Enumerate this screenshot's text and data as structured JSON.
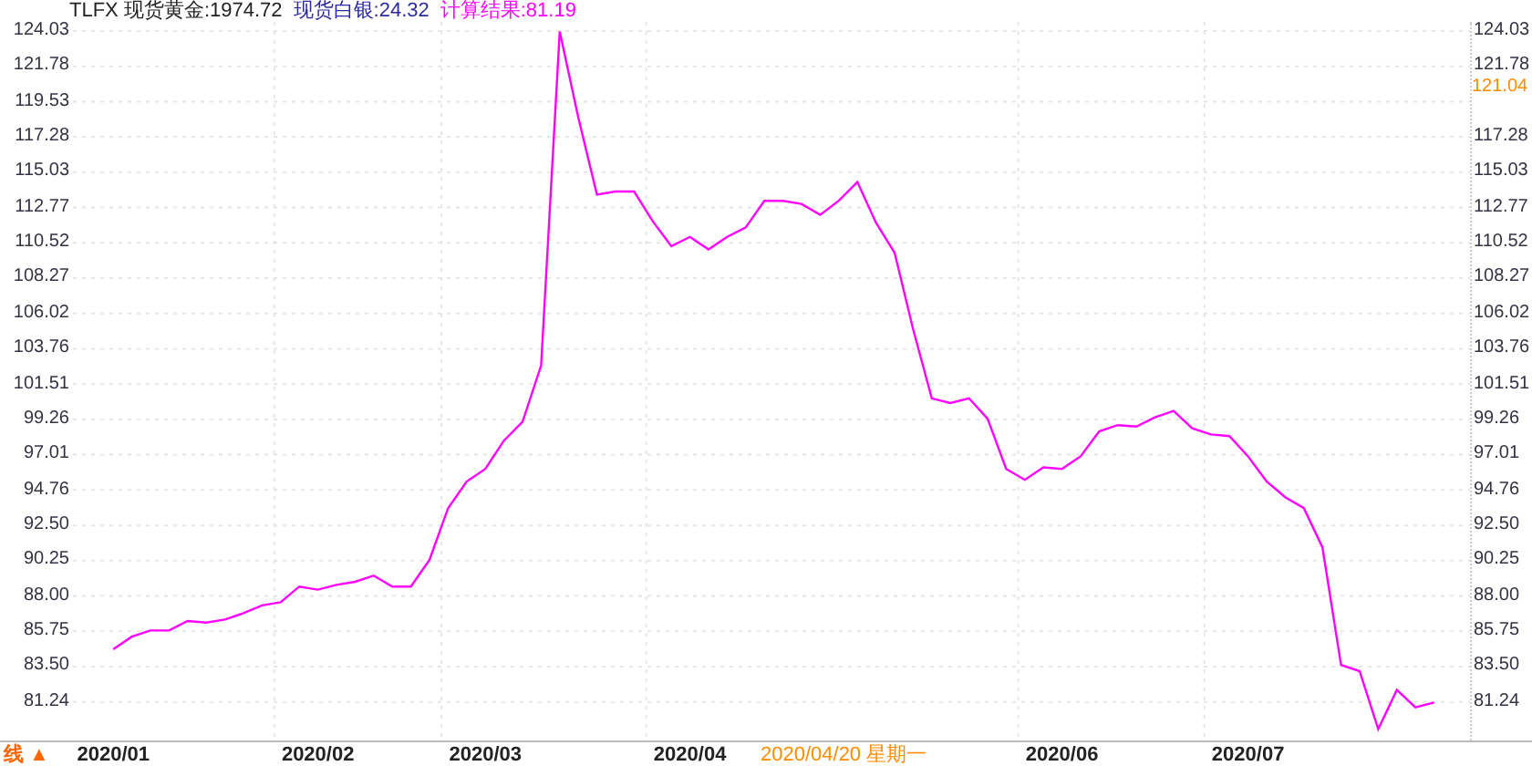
{
  "legend": [
    {
      "text": "TLFX 现货黄金:1974.72",
      "color": "#222222"
    },
    {
      "text": "现货白银:24.32",
      "color": "#2b2b9e"
    },
    {
      "text": "计算结果:81.19",
      "color": "#ff00ff"
    }
  ],
  "chart_data": {
    "type": "line",
    "grid": true,
    "ylim": [
      78.9,
      124.03
    ],
    "yticks": [
      {
        "value": 124.03,
        "label": "124.03"
      },
      {
        "value": 121.78,
        "label": "121.78"
      },
      {
        "value": 119.53,
        "label": "119.53"
      },
      {
        "value": 117.28,
        "label": "117.28"
      },
      {
        "value": 115.03,
        "label": "115.03"
      },
      {
        "value": 112.77,
        "label": "112.77"
      },
      {
        "value": 110.52,
        "label": "110.52"
      },
      {
        "value": 108.27,
        "label": "108.27"
      },
      {
        "value": 106.02,
        "label": "106.02"
      },
      {
        "value": 103.76,
        "label": "103.76"
      },
      {
        "value": 101.51,
        "label": "101.51"
      },
      {
        "value": 99.26,
        "label": "99.26"
      },
      {
        "value": 97.01,
        "label": "97.01"
      },
      {
        "value": 94.76,
        "label": "94.76"
      },
      {
        "value": 92.5,
        "label": "92.50"
      },
      {
        "value": 90.25,
        "label": "90.25"
      },
      {
        "value": 88,
        "label": "88.00"
      },
      {
        "value": 85.75,
        "label": "85.75"
      },
      {
        "value": 83.5,
        "label": "83.50"
      },
      {
        "value": 81.24,
        "label": "81.24"
      }
    ],
    "categories": [
      null,
      null,
      "2020/01",
      null,
      null,
      null,
      null,
      null,
      null,
      null,
      null,
      null,
      null,
      "2020/02",
      null,
      null,
      null,
      null,
      null,
      null,
      null,
      null,
      "2020/03",
      null,
      null,
      null,
      null,
      null,
      null,
      null,
      null,
      null,
      null,
      "2020/04",
      null,
      null,
      null,
      null,
      null,
      null,
      null,
      null,
      null,
      null,
      null,
      null,
      null,
      null,
      null,
      null,
      null,
      null,
      null,
      "2020/06",
      null,
      null,
      null,
      null,
      null,
      null,
      null,
      null,
      null,
      "2020/07",
      null,
      null,
      null,
      null,
      null,
      null,
      null,
      null,
      null,
      null
    ],
    "series": [
      {
        "color": "#ff00ff",
        "values": [
          null,
          null,
          84.6,
          85.4,
          85.8,
          85.8,
          86.4,
          86.3,
          86.5,
          86.9,
          87.4,
          87.6,
          88.6,
          88.4,
          88.7,
          88.9,
          89.3,
          88.6,
          88.6,
          90.3,
          93.6,
          95.3,
          96.1,
          97.9,
          99.1,
          102.7,
          124.0,
          118.5,
          113.6,
          113.8,
          113.8,
          111.9,
          110.3,
          110.9,
          110.1,
          110.9,
          111.5,
          113.2,
          113.2,
          113.0,
          112.3,
          113.2,
          114.4,
          111.8,
          109.9,
          105.0,
          100.6,
          100.3,
          100.6,
          99.3,
          96.1,
          95.4,
          96.2,
          96.1,
          96.9,
          98.5,
          98.9,
          98.8,
          99.4,
          99.8,
          98.7,
          98.3,
          98.2,
          96.9,
          95.3,
          94.3,
          93.6,
          91.1,
          83.6,
          83.2,
          79.5,
          82.0,
          80.9,
          81.2
        ]
      }
    ],
    "annotations": [
      "2020/04/20 星期一"
    ]
  },
  "right_axis": {
    "upper": [
      "124.03",
      "121.78"
    ],
    "lower": [
      "117.28",
      "115.03",
      "112.77",
      "110.52",
      "108.27",
      "106.02",
      "103.76",
      "101.51",
      "99.26",
      "97.01",
      "94.76",
      "92.50",
      "90.25",
      "88.00",
      "85.75",
      "83.50",
      "81.24"
    ],
    "cursor_value": "121.04"
  },
  "footer": {
    "toggle": "线 ▲"
  }
}
